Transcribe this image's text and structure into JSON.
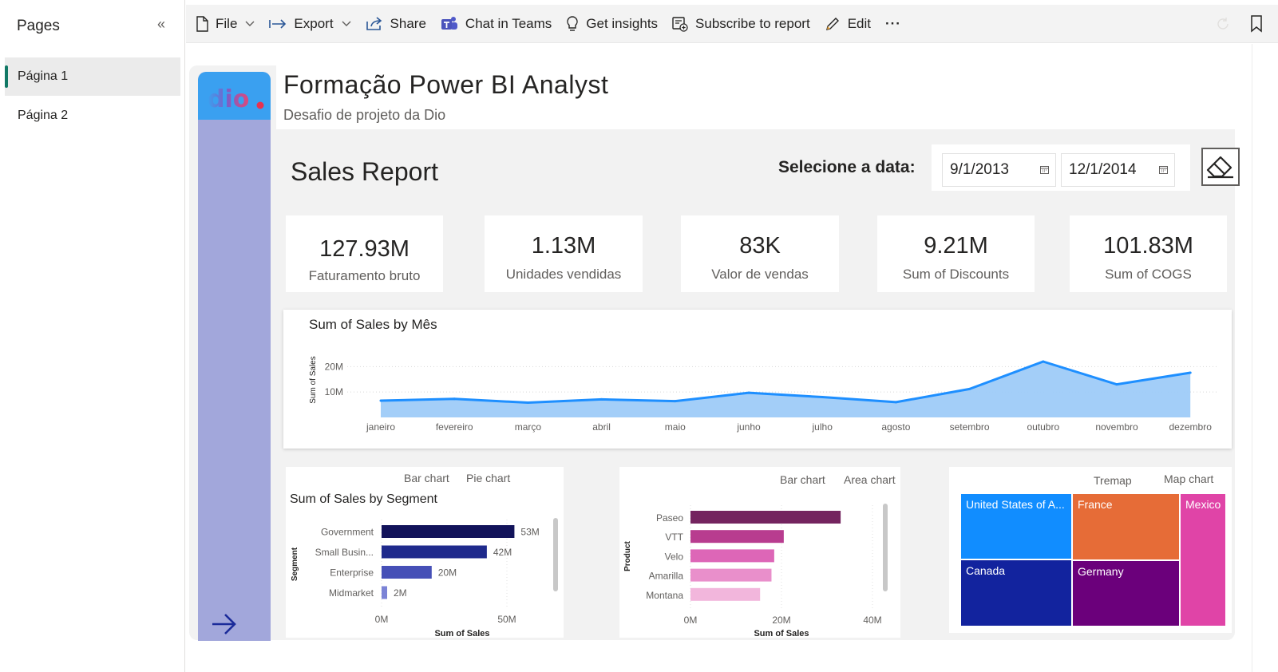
{
  "pages_pane": {
    "title": "Pages",
    "pages": [
      "Página 1",
      "Página 2"
    ]
  },
  "toolbar": {
    "file": "File",
    "export": "Export",
    "share": "Share",
    "teams": "Chat in Teams",
    "insights": "Get insights",
    "subscribe": "Subscribe to report",
    "edit": "Edit",
    "more": "···"
  },
  "report": {
    "title": "Formação Power BI Analyst",
    "subtitle": "Desafio de projeto da Dio",
    "sales_title": "Sales Report",
    "date_label": "Selecione a data:",
    "date_start": "9/1/2013",
    "date_end": "12/1/2014"
  },
  "kpis": [
    {
      "value": "127.93M",
      "label": "Faturamento bruto"
    },
    {
      "value": "1.13M",
      "label": "Unidades vendidas"
    },
    {
      "value": "83K",
      "label": "Valor de vendas"
    },
    {
      "value": "9.21M",
      "label": "Sum of Discounts"
    },
    {
      "value": "101.83M",
      "label": "Sum of COGS"
    }
  ],
  "segment_tabs": [
    "Bar chart",
    "Pie chart"
  ],
  "product_tabs": [
    "Bar chart",
    "Area chart"
  ],
  "country_tabs": [
    "Tremap",
    "Map chart"
  ],
  "colors": {
    "accent_green": "#117865",
    "area_fill": "#9ecbf8",
    "area_line": "#1e8fff",
    "side_nav": "#a2a7db",
    "side_top": "#3aa0f0"
  },
  "chart_data": [
    {
      "type": "area",
      "title": "Sum of Sales by Mês",
      "xlabel": "",
      "ylabel": "Sum of Sales",
      "categories": [
        "janeiro",
        "fevereiro",
        "março",
        "abril",
        "maio",
        "junho",
        "julho",
        "agosto",
        "setembro",
        "outubro",
        "novembro",
        "dezembro"
      ],
      "values": [
        6.6,
        7.3,
        5.8,
        7.1,
        6.4,
        9.7,
        8.0,
        6.0,
        11.2,
        22.0,
        13.0,
        17.6
      ],
      "unit": "M",
      "yticks": [
        "10M",
        "20M"
      ],
      "ylim": [
        0,
        25
      ],
      "grid": true
    },
    {
      "type": "bar",
      "orientation": "horizontal",
      "title": "Sum of Sales by Segment",
      "xlabel": "Sum of Sales",
      "ylabel": "Segment",
      "categories": [
        "Government",
        "Small Busin...",
        "Enterprise",
        "Midmarket"
      ],
      "values": [
        53,
        42,
        20,
        2
      ],
      "data_labels": [
        "53M",
        "42M",
        "20M",
        "2M"
      ],
      "colors": [
        "#12135a",
        "#1f2a8c",
        "#4650b7",
        "#7b83d6"
      ],
      "xticks": [
        "0M",
        "50M"
      ],
      "xlim": [
        0,
        60
      ]
    },
    {
      "type": "bar",
      "orientation": "horizontal",
      "title": "",
      "xlabel": "Sum of Sales",
      "ylabel": "Product",
      "categories": [
        "Paseo",
        "VTT",
        "Velo",
        "Amarilla",
        "Montana"
      ],
      "values": [
        33,
        20.5,
        18.4,
        17.8,
        15.3
      ],
      "colors": [
        "#74245f",
        "#b83c8f",
        "#dd66b7",
        "#e98fcb",
        "#f2b6dc"
      ],
      "xticks": [
        "0M",
        "20M",
        "40M"
      ],
      "xlim": [
        0,
        40
      ]
    },
    {
      "type": "heatmap",
      "subtype": "treemap",
      "title": "",
      "labels": [
        "United States of A...",
        "France",
        "Mexico",
        "Canada",
        "Germany"
      ],
      "colors": [
        "#118dff",
        "#e66c37",
        "#e044a7",
        "#12239e",
        "#6b007b"
      ]
    }
  ]
}
